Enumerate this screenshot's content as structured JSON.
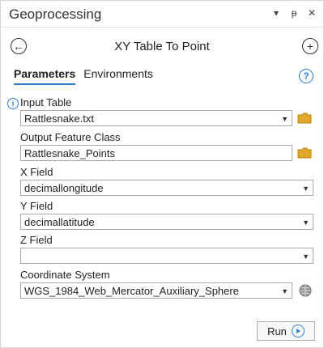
{
  "pane": {
    "title": "Geoprocessing",
    "tool_name": "XY Table To Point"
  },
  "tabs": [
    {
      "label": "Parameters",
      "active": true
    },
    {
      "label": "Environments",
      "active": false
    }
  ],
  "fields": {
    "input_table": {
      "label": "Input Table",
      "value": "Rattlesnake.txt"
    },
    "output_feature_class": {
      "label": "Output Feature Class",
      "value": "Rattlesnake_Points"
    },
    "x_field": {
      "label": "X Field",
      "value": "decimallongitude"
    },
    "y_field": {
      "label": "Y Field",
      "value": "decimallatitude"
    },
    "z_field": {
      "label": "Z Field",
      "value": ""
    },
    "coordinate_system": {
      "label": "Coordinate System",
      "value": "WGS_1984_Web_Mercator_Auxiliary_Sphere"
    }
  },
  "run_button": {
    "label": "Run"
  },
  "icons": {
    "back": "back-arrow-icon",
    "add": "add-icon",
    "help": "help-icon",
    "info": "info-icon",
    "browse": "folder-icon",
    "coordinate": "globe-icon",
    "run": "play-icon"
  },
  "colors": {
    "accent": "#2a7fd4",
    "folder": "#e0a82e"
  }
}
